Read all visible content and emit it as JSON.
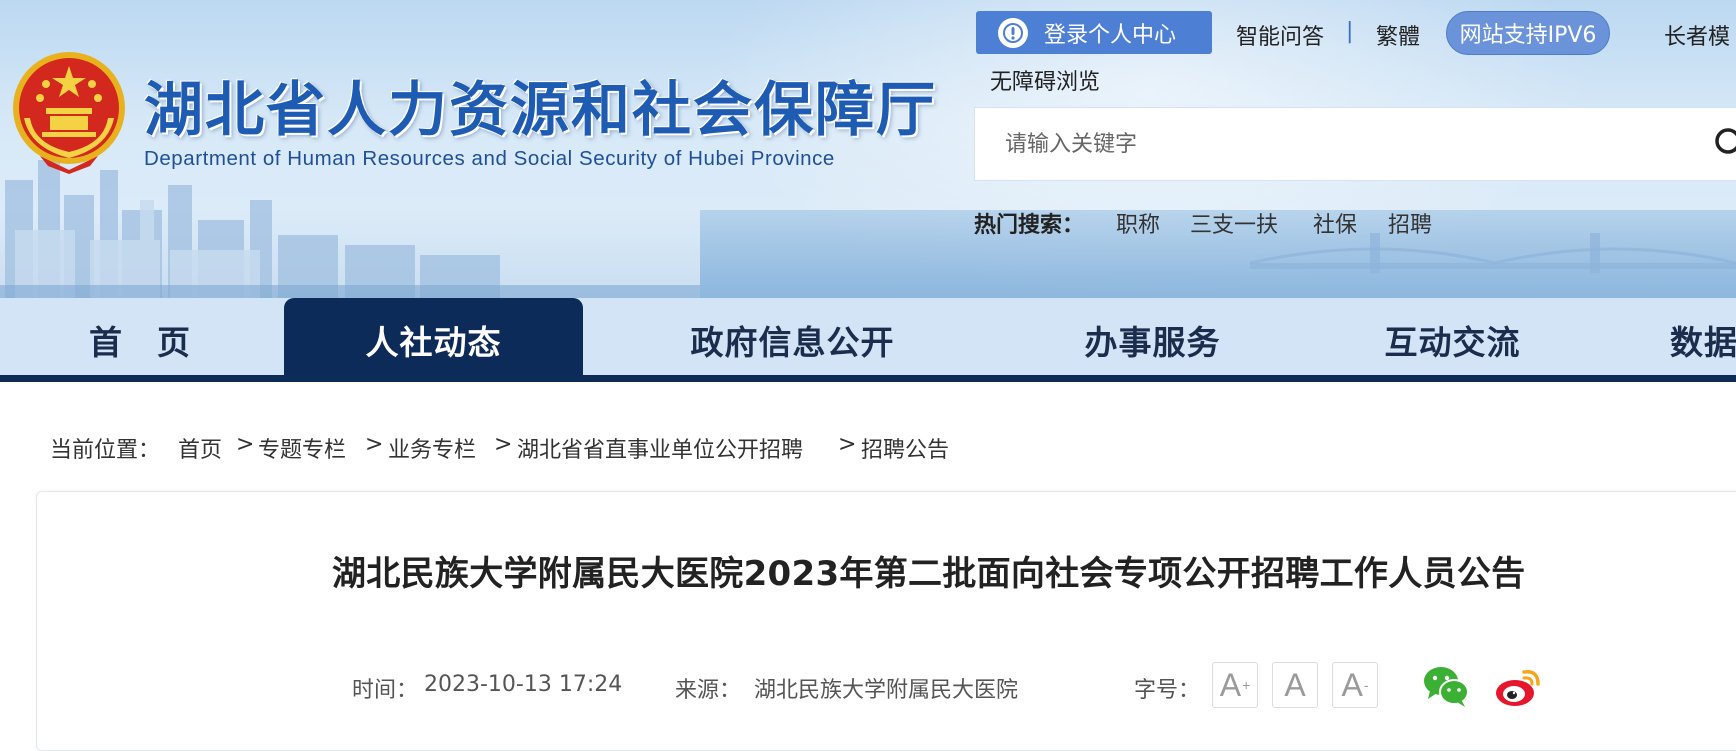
{
  "header": {
    "site_title": "湖北省人力资源和社会保障厅",
    "site_title_en": "Department of Human Resources and Social Security of Hubei Province",
    "login_label": "登录个人中心",
    "links": {
      "qa": "智能问答",
      "separator": "|",
      "traditional": "繁體",
      "ipv6": "网站支持IPV6",
      "elder": "长者模",
      "accessible": "无障碍浏览"
    },
    "search": {
      "placeholder": "请输入关键字",
      "value": ""
    },
    "hot_search": {
      "label": "热门搜索：",
      "words": [
        "职称",
        "三支一扶",
        "社保",
        "招聘"
      ]
    }
  },
  "nav": {
    "items": [
      "首　页",
      "人社动态",
      "政府信息公开",
      "办事服务",
      "互动交流",
      "数据"
    ],
    "active_index": 1
  },
  "breadcrumb": {
    "label": "当前位置：",
    "items": [
      "首页",
      "专题专栏",
      "业务专栏",
      "湖北省省直事业单位公开招聘",
      "招聘公告"
    ],
    "separator": ">"
  },
  "article": {
    "title": "湖北民族大学附属民大医院2023年第二批面向社会专项公开招聘工作人员公告",
    "time_label": "时间：",
    "time_value": "2023-10-13 17:24",
    "source_label": "来源：",
    "source_value": "湖北民族大学附属民大医院",
    "font_size_label": "字号："
  },
  "colors": {
    "title_blue": "#1e5bb3",
    "nav_active": "#0d2b58",
    "nav_bg": "#d3e4f6",
    "login_btn": "#4d7fd5",
    "wechat_green": "#3cb034",
    "weibo_red": "#e6162d",
    "weibo_orange": "#f7a51c"
  },
  "icons": {
    "emblem": "national-emblem",
    "login": "user-icon",
    "search": "search-icon",
    "share_wechat": "wechat-icon",
    "share_weibo": "weibo-icon"
  }
}
